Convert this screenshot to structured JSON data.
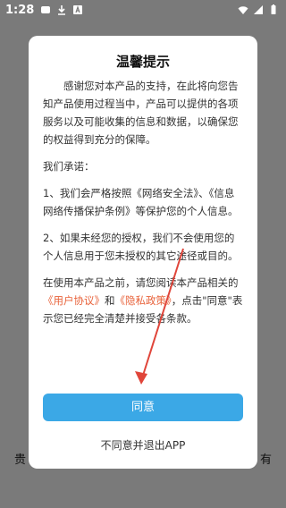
{
  "status_bar": {
    "time": "1:28",
    "icons_left": [
      "notification-icon",
      "download-icon",
      "app-icon"
    ],
    "icons_right": [
      "wifi-icon",
      "signal-icon",
      "battery-icon"
    ]
  },
  "background": {
    "left_text": "贵",
    "right_text": "有"
  },
  "dialog": {
    "title": "温馨提示",
    "para1": "感谢您对本产品的支持，在此将向您告知产品使用过程当中，产品可以提供的各项服务以及可能收集的信息和数据，以确保您的权益得到充分的保障。",
    "para2": "我们承诺：",
    "para3": "1、我们会严格按照《网络安全法》、《信息网络传播保护条例》等保护您的个人信息。",
    "para4": "2、如果未经您的授权，我们不会使用您的个人信息用于您未授权的其它途径或目的。",
    "para5_prefix": "在使用本产品之前，请您阅读本产品相关的",
    "user_agreement_link": "《用户协议》",
    "para5_and": "和",
    "privacy_policy_link": "《隐私政策》",
    "para5_suffix": "，点击\"同意\"表示您已经完全清楚并接受各条款。",
    "agree_button": "同意",
    "decline_link": "不同意并退出APP"
  },
  "colors": {
    "accent": "#3ba8e6",
    "link": "#e8623a",
    "arrow": "#e0453a"
  }
}
